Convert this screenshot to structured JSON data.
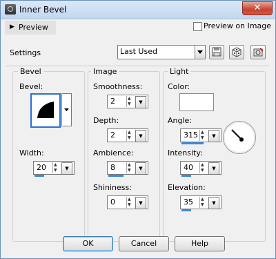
{
  "window": {
    "title": "Inner Bevel",
    "close_glyph": "✕"
  },
  "preview": {
    "label": "Preview",
    "arrow": "▶"
  },
  "preview_on_image": {
    "label": "Preview on Image",
    "checked": false
  },
  "settings": {
    "label": "Settings",
    "preset": "Last Used"
  },
  "toolbar": {
    "icons": [
      "save-preset-icon",
      "dice-randomize-icon",
      "delete-preset-icon"
    ]
  },
  "bevel": {
    "group_title": "Bevel",
    "bevel_label": "Bevel:",
    "width_label": "Width:",
    "width_value": "20",
    "width_fraction": 0.4
  },
  "image": {
    "group_title": "Image",
    "smoothness_label": "Smoothness:",
    "smoothness_value": "2",
    "depth_label": "Depth:",
    "depth_value": "2",
    "ambience_label": "Ambience:",
    "ambience_value": "8",
    "ambience_fraction": 0.6,
    "shininess_label": "Shininess:",
    "shininess_value": "0"
  },
  "light": {
    "group_title": "Light",
    "color_label": "Color:",
    "color_value": "#ffffff",
    "angle_label": "Angle:",
    "angle_value": "315",
    "angle_fraction": 0.875,
    "intensity_label": "Intensity:",
    "intensity_value": "40",
    "intensity_fraction": 0.4,
    "elevation_label": "Elevation:",
    "elevation_value": "35",
    "elevation_fraction": 0.39
  },
  "buttons": {
    "ok": "OK",
    "cancel": "Cancel",
    "help": "Help"
  },
  "colors": {
    "accent": "#3c8ad8",
    "close": "#c7422f",
    "focus": "#2a6fd6"
  }
}
